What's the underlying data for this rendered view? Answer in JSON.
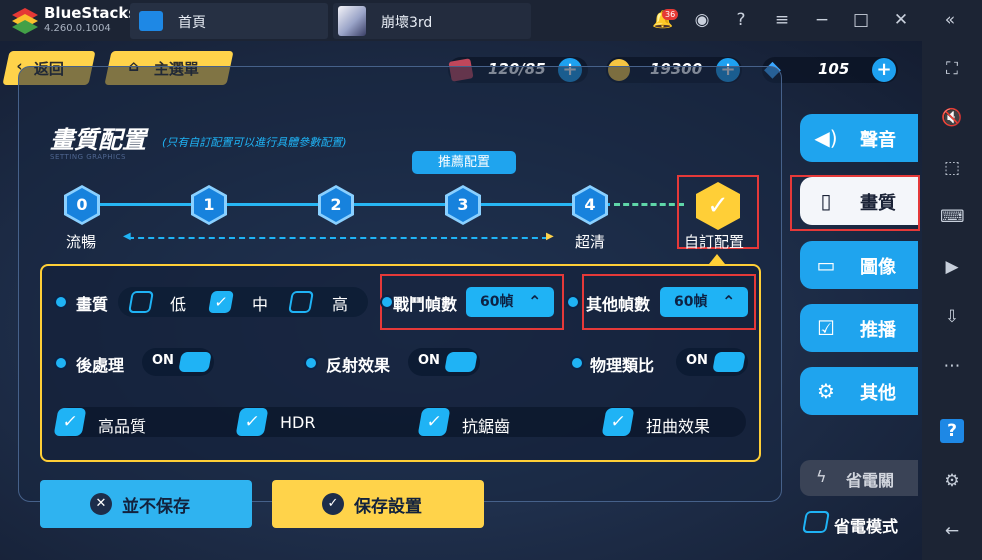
{
  "window": {
    "app_name": "BlueStacks",
    "version": "4.260.0.1004",
    "tabs": [
      {
        "label": "首頁"
      },
      {
        "label": "崩壞3rd"
      }
    ],
    "notification_count": "36"
  },
  "game": {
    "back_label": "返回",
    "main_menu_label": "主選單",
    "resources": {
      "stamina": "120/85",
      "coins": "19300",
      "crystals": "105"
    },
    "panel": {
      "title": "畫質配置",
      "subtitle": "(只有自訂配置可以進行具體參數配置)",
      "subtitle_en": "SETTING GRAPHICS",
      "recommended_tag": "推薦配置",
      "nodes": [
        "0",
        "1",
        "2",
        "3",
        "4"
      ],
      "low_label": "流暢",
      "high_label": "超清",
      "custom_label": "自訂配置"
    },
    "settings": {
      "quality_label": "畫質",
      "quality_options": [
        "低",
        "中",
        "高"
      ],
      "quality_selected": "中",
      "battle_fps_label": "戰鬥幀數",
      "battle_fps_value": "60幀",
      "other_fps_label": "其他幀數",
      "other_fps_value": "60幀",
      "postprocess_label": "後處理",
      "reflection_label": "反射效果",
      "physics_label": "物理類比",
      "toggle_on": "ON",
      "checkboxes": [
        "高品質",
        "HDR",
        "抗鋸齒",
        "扭曲效果"
      ]
    },
    "buttons": {
      "no_save": "並不保存",
      "save": "保存設置"
    },
    "right_tabs": [
      "聲音",
      "畫質",
      "圖像",
      "推播",
      "其他"
    ],
    "active_tab": "畫質",
    "power_save": "省電關",
    "power_mode": "省電模式"
  },
  "colors": {
    "accent_blue": "#1fb3f5",
    "accent_yellow": "#ffcf37",
    "highlight_red": "#e53939"
  }
}
